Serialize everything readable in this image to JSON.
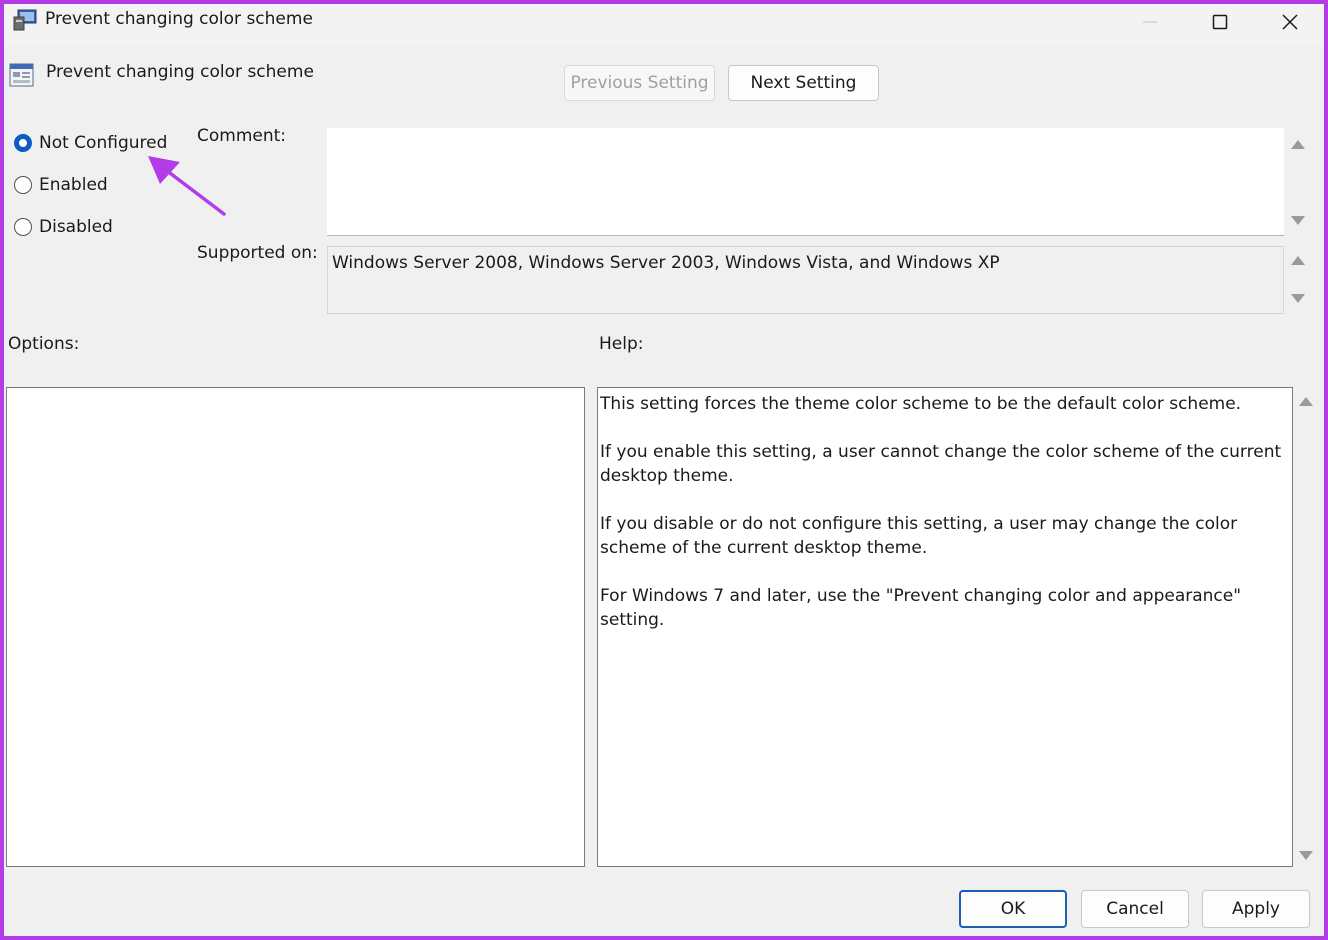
{
  "window": {
    "title": "Prevent changing color scheme",
    "controls": {
      "minimize": "minimize",
      "maximize": "maximize",
      "close": "close"
    }
  },
  "header": {
    "setting_name": "Prevent changing color scheme",
    "previous_label": "Previous Setting",
    "next_label": "Next Setting"
  },
  "state": {
    "options": [
      "Not Configured",
      "Enabled",
      "Disabled"
    ],
    "selected": "Not Configured"
  },
  "comment": {
    "label": "Comment:",
    "value": ""
  },
  "supported_on": {
    "label": "Supported on:",
    "value": "Windows Server 2008, Windows Server 2003, Windows Vista, and Windows XP"
  },
  "options_panel": {
    "label": "Options:"
  },
  "help_panel": {
    "label": "Help:",
    "paragraphs": [
      "This setting forces the theme color scheme to be the default color scheme.",
      "If you enable this setting, a user cannot change the color scheme of the current desktop theme.",
      "If you disable or do not configure this setting, a user may change the color scheme of the current desktop theme.",
      "For Windows 7 and later, use the \"Prevent changing color and appearance\" setting."
    ]
  },
  "footer": {
    "ok_label": "OK",
    "cancel_label": "Cancel",
    "apply_label": "Apply"
  },
  "colors": {
    "accent": "#0d5bc6",
    "annotation": "#b23de8",
    "frame": "#b23de8"
  }
}
